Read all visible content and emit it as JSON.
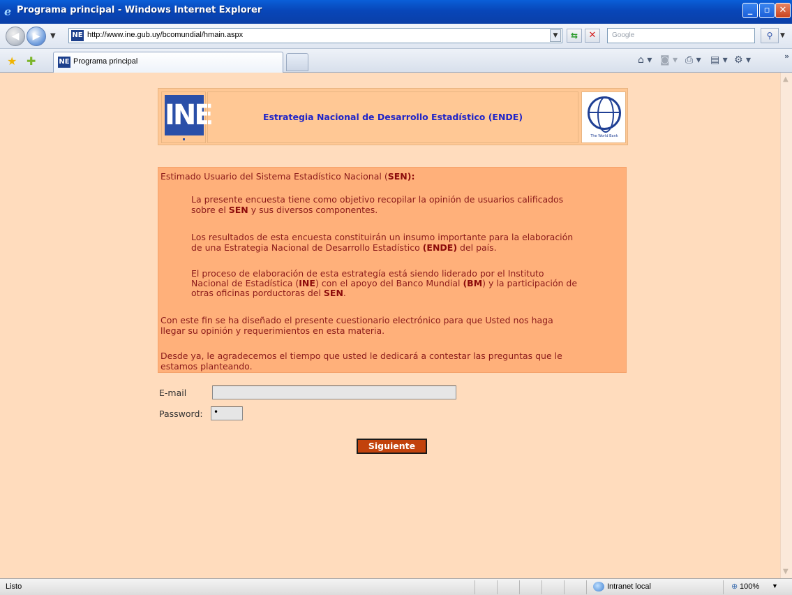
{
  "window": {
    "title": "Programa principal - Windows Internet Explorer"
  },
  "address_bar": {
    "url": "http://www.ine.gub.uy/bcomundial/hmain.aspx",
    "search_placeholder": "Google"
  },
  "tab": {
    "label": "Programa principal"
  },
  "favicon_text": "NE",
  "header": {
    "logo_text": "INE",
    "title": "Estrategia Nacional de Desarrollo Estadístico (ENDE)",
    "wb_logo_text": "The World Bank"
  },
  "intro": {
    "greeting_prefix": "Estimado Usuario del Sistema Estadístico Nacional (",
    "greeting_bold": "SEN",
    "greeting_suffix": "):",
    "p1_line1": "La presente encuesta tiene como objetivo recopilar la opinión de usuarios calificados",
    "p1_line2_prefix": "sobre el ",
    "p1_line2_bold": "SEN",
    "p1_line2_suffix": " y sus diversos componentes.",
    "p2_line1": "Los resultados de esta encuesta constituirán un insumo importante para la elaboración",
    "p2_line2_prefix": "de una Estrategia Nacional de Desarrollo Estadístico ",
    "p2_line2_bold": "(ENDE)",
    "p2_line2_suffix": " del país.",
    "p3_line1": "El proceso de elaboración de esta estrategía está siendo liderado por el Instituto",
    "p3_line2_a": "Nacional de Estadística (",
    "p3_line2_b": "INE",
    "p3_line2_c": ") con el apoyo del  Banco Mundial ",
    "p3_line2_d": "(BM",
    "p3_line2_e": ") y la participación de",
    "p3_line3_prefix": "otras oficinas porductoras del ",
    "p3_line3_bold": "SEN",
    "p3_line3_suffix": ".",
    "p4_line1": "Con este fin se ha diseñado el presente cuestionario electrónico para que Usted nos haga",
    "p4_line2": "llegar su opinión y requerimientos en esta materia.",
    "p5_line1": "Desde ya, le agradecemos el tiempo que usted le dedicará a contestar las preguntas que le",
    "p5_line2": "estamos planteando."
  },
  "form": {
    "email_label": "E-mail",
    "email_value": "",
    "password_label": "Password:",
    "password_value": "•",
    "submit_label": "Siguiente"
  },
  "status_bar": {
    "status": "Listo",
    "zone": "Intranet local",
    "zoom": "100%"
  },
  "colors": {
    "page_bg": "#ffdcbd",
    "info_box_bg": "#ffb07a",
    "header_bg": "#ffc895",
    "text_dark_red": "#8b1a1a",
    "title_blue": "#1f24c8",
    "button_bg": "#c2420c"
  },
  "icons": [
    "ie-icon",
    "back-arrow-icon",
    "forward-arrow-icon",
    "refresh-icon",
    "stop-icon",
    "search-icon",
    "favorites-star-icon",
    "add-favorites-icon",
    "home-icon",
    "feeds-icon",
    "print-icon",
    "page-icon",
    "tools-icon",
    "intranet-zone-icon",
    "zoom-icon"
  ]
}
